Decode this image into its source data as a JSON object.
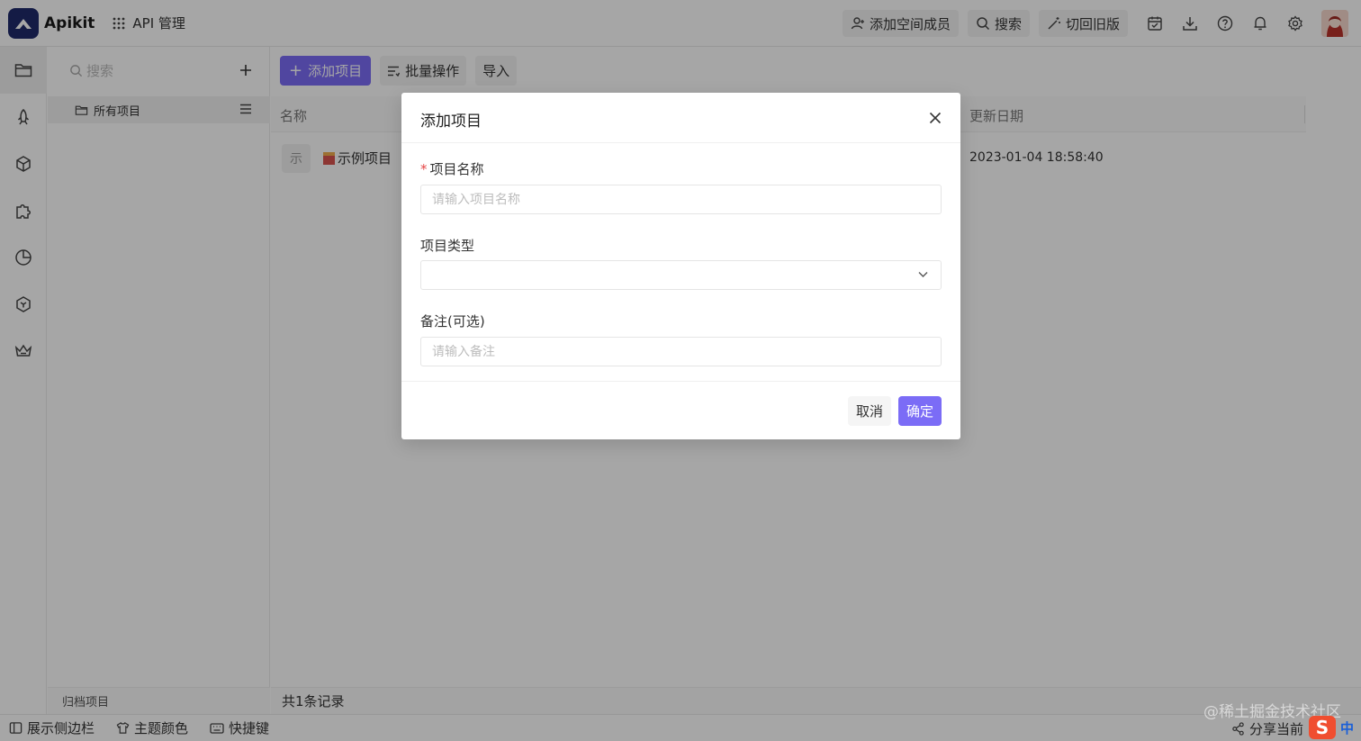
{
  "app": {
    "brand": "Apikit",
    "module": "API 管理"
  },
  "header": {
    "add_member": "添加空间成员",
    "search": "搜索",
    "switch_old": "切回旧版"
  },
  "tree": {
    "search_placeholder": "搜索",
    "all_projects": "所有项目",
    "archived": "归档项目"
  },
  "toolbar": {
    "add_project": "添加项目",
    "batch": "批量操作",
    "import": "导入"
  },
  "table": {
    "columns": [
      "名称",
      "更新日期"
    ],
    "rows": [
      {
        "icon_text": "示",
        "name": "示例项目",
        "updated": "2023-01-04 18:58:40"
      }
    ],
    "footer": "共1条记录"
  },
  "statusbar": {
    "show_sidebar": "展示侧边栏",
    "theme": "主题颜色",
    "shortcuts": "快捷键",
    "share": "分享当前",
    "watermark": "@稀土掘金技术社区",
    "ime_logo": "S",
    "ime_lang": "中"
  },
  "modal": {
    "title": "添加项目",
    "name_label": "项目名称",
    "name_required_mark": "*",
    "name_value": "",
    "name_placeholder": "请输入项目名称",
    "type_label": "项目类型",
    "type_value": "",
    "note_label": "备注(可选)",
    "note_value": "",
    "note_placeholder": "请输入备注",
    "cancel": "取消",
    "confirm": "确定"
  },
  "colors": {
    "primary": "#7b6cf6",
    "logo_bg": "#1f2a6b",
    "required": "#e54545"
  }
}
